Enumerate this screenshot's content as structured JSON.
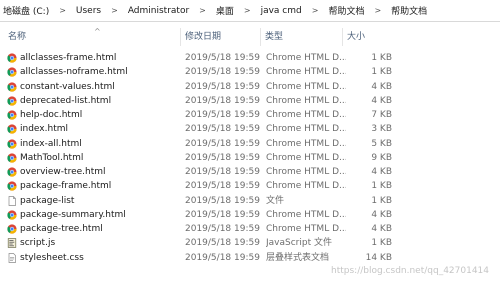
{
  "breadcrumb": [
    {
      "label": "地磁盘 (C:)"
    },
    {
      "label": "Users"
    },
    {
      "label": "Administrator"
    },
    {
      "label": "桌面"
    },
    {
      "label": "java cmd"
    },
    {
      "label": "帮助文档"
    },
    {
      "label": "帮助文档"
    }
  ],
  "breadcrumb_sep": ">",
  "columns": {
    "name": "名称",
    "date": "修改日期",
    "type": "类型",
    "size": "大小",
    "sort_arrow": "^"
  },
  "files": [
    {
      "name": "allclasses-frame.html",
      "date": "2019/5/18 19:59",
      "type": "Chrome HTML D...",
      "size": "1 KB",
      "icon": "chrome-html-icon"
    },
    {
      "name": "allclasses-noframe.html",
      "date": "2019/5/18 19:59",
      "type": "Chrome HTML D...",
      "size": "1 KB",
      "icon": "chrome-html-icon"
    },
    {
      "name": "constant-values.html",
      "date": "2019/5/18 19:59",
      "type": "Chrome HTML D...",
      "size": "4 KB",
      "icon": "chrome-html-icon"
    },
    {
      "name": "deprecated-list.html",
      "date": "2019/5/18 19:59",
      "type": "Chrome HTML D...",
      "size": "4 KB",
      "icon": "chrome-html-icon"
    },
    {
      "name": "help-doc.html",
      "date": "2019/5/18 19:59",
      "type": "Chrome HTML D...",
      "size": "7 KB",
      "icon": "chrome-html-icon"
    },
    {
      "name": "index.html",
      "date": "2019/5/18 19:59",
      "type": "Chrome HTML D...",
      "size": "3 KB",
      "icon": "chrome-html-icon"
    },
    {
      "name": "index-all.html",
      "date": "2019/5/18 19:59",
      "type": "Chrome HTML D...",
      "size": "5 KB",
      "icon": "chrome-html-icon"
    },
    {
      "name": "MathTool.html",
      "date": "2019/5/18 19:59",
      "type": "Chrome HTML D...",
      "size": "9 KB",
      "icon": "chrome-html-icon"
    },
    {
      "name": "overview-tree.html",
      "date": "2019/5/18 19:59",
      "type": "Chrome HTML D...",
      "size": "4 KB",
      "icon": "chrome-html-icon"
    },
    {
      "name": "package-frame.html",
      "date": "2019/5/18 19:59",
      "type": "Chrome HTML D...",
      "size": "1 KB",
      "icon": "chrome-html-icon"
    },
    {
      "name": "package-list",
      "date": "2019/5/18 19:59",
      "type": "文件",
      "size": "1 KB",
      "icon": "file-icon"
    },
    {
      "name": "package-summary.html",
      "date": "2019/5/18 19:59",
      "type": "Chrome HTML D...",
      "size": "4 KB",
      "icon": "chrome-html-icon"
    },
    {
      "name": "package-tree.html",
      "date": "2019/5/18 19:59",
      "type": "Chrome HTML D...",
      "size": "4 KB",
      "icon": "chrome-html-icon"
    },
    {
      "name": "script.js",
      "date": "2019/5/18 19:59",
      "type": "JavaScript 文件",
      "size": "1 KB",
      "icon": "script-icon"
    },
    {
      "name": "stylesheet.css",
      "date": "2019/5/18 19:59",
      "type": "层叠样式表文档",
      "size": "14 KB",
      "icon": "css-file-icon"
    }
  ],
  "watermark": "https://blog.csdn.net/qq_42701414"
}
